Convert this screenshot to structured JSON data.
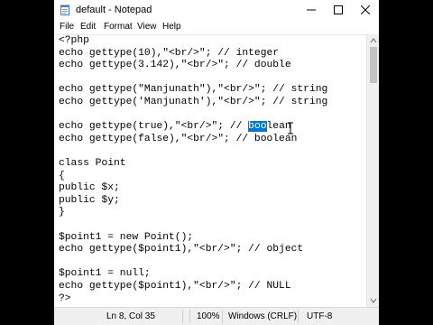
{
  "window": {
    "title": "default - Notepad",
    "icon": "notepad-icon",
    "controls": [
      "minimize-icon",
      "maximize-icon",
      "close-icon"
    ]
  },
  "menu": [
    "File",
    "Edit",
    "Format",
    "View",
    "Help"
  ],
  "editor": {
    "lines": [
      "<?php",
      "echo gettype(10),\"<br/>\"; // integer",
      "echo gettype(3.142),\"<br/>\"; // double",
      "",
      "echo gettype(\"Manjunath\"),\"<br/>\"; // string",
      "echo gettype('Manjunath'),\"<br/>\"; // string",
      "",
      "echo gettype(true),\"<br/>\"; // ",
      "echo gettype(false),\"<br/>\"; // boolean",
      "",
      "class Point",
      "{",
      "public $x;",
      "public $y;",
      "}",
      "",
      "$point1 = new Point();",
      "echo gettype($point1),\"<br/>\"; // object",
      "",
      "$point1 = null;",
      "echo gettype($point1),\"<br/>\"; // NULL",
      "?>"
    ],
    "selected_text": "boo",
    "after_selection": "lean",
    "selection_color": "#0078d7"
  },
  "status": {
    "position": "Ln 8, Col 35",
    "zoom": "100%",
    "line_ending": "Windows (CRLF)",
    "encoding": "UTF-8"
  }
}
